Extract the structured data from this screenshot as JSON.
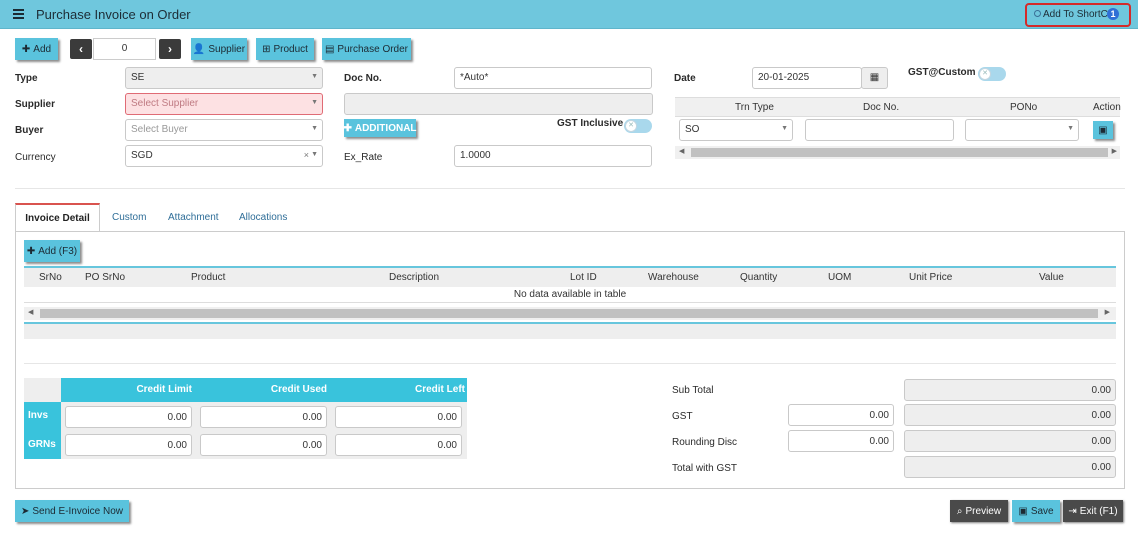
{
  "title": "Purchase Invoice on Order",
  "shortcut": {
    "label": "Add To ShortCut",
    "badge": "1"
  },
  "toolbar": {
    "add": "Add",
    "record_no": "0",
    "supplier": "Supplier",
    "product": "Product",
    "purchase_order": "Purchase Order"
  },
  "form": {
    "type_label": "Type",
    "type_value": "SE",
    "supplier_label": "Supplier",
    "supplier_placeholder": "Select Supplier",
    "buyer_label": "Buyer",
    "buyer_placeholder": "Select Buyer",
    "currency_label": "Currency",
    "currency_value": "SGD",
    "currency_clear": "×",
    "docno_label": "Doc No.",
    "docno_value": "*Auto*",
    "additional": "ADDITIONAL",
    "gst_inclusive": "GST Inclusive",
    "exrate_label": "Ex_Rate",
    "exrate_value": "1.0000",
    "date_label": "Date",
    "date_value": "20-01-2025",
    "gst_custom": "GST@Custom"
  },
  "ref_grid": {
    "headers": [
      "Trn Type",
      "Doc No.",
      "PONo",
      "Action"
    ],
    "row": {
      "trn_type": "SO",
      "doc_no": "",
      "pono": ""
    }
  },
  "tabs": [
    "Invoice Detail",
    "Custom",
    "Attachment",
    "Allocations"
  ],
  "detail": {
    "add": "Add (F3)",
    "headers": [
      "SrNo",
      "PO SrNo",
      "Product",
      "Description",
      "Lot ID",
      "Warehouse",
      "Quantity",
      "UOM",
      "Unit Price",
      "Value"
    ],
    "empty": "No data available in table"
  },
  "credit": {
    "headers": [
      "Credit Limit",
      "Credit Used",
      "Credit Left"
    ],
    "rows": [
      {
        "label": "Invs",
        "values": [
          "0.00",
          "0.00",
          "0.00"
        ]
      },
      {
        "label": "GRNs",
        "values": [
          "0.00",
          "0.00",
          "0.00"
        ]
      }
    ]
  },
  "summary": {
    "sub_total_label": "Sub Total",
    "sub_total": "0.00",
    "gst_label": "GST",
    "gst_input": "0.00",
    "gst": "0.00",
    "rounding_label": "Rounding Disc",
    "rounding_input": "0.00",
    "rounding": "0.00",
    "total_label": "Total with GST",
    "total": "0.00"
  },
  "footer": {
    "send_einvoice": "Send E-Invoice Now",
    "preview": "Preview",
    "save": "Save",
    "exit": "Exit (F1)"
  }
}
